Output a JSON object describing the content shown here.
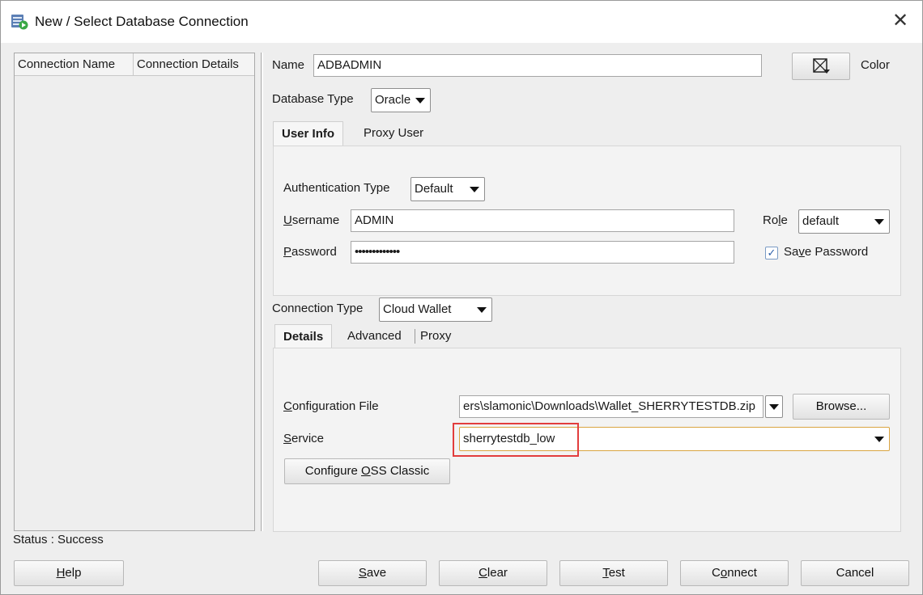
{
  "window": {
    "title": "New / Select Database Connection",
    "icons": {
      "app": "database-connection-icon",
      "close": "close-icon"
    }
  },
  "connection_list": {
    "columns": [
      "Connection Name",
      "Connection Details"
    ]
  },
  "form": {
    "name_label": "Name",
    "name_value": "ADBADMIN",
    "color_label": "Color",
    "database_type_label": "Database Type",
    "database_type_value": "Oracle",
    "tabs": [
      "User Info",
      "Proxy User"
    ],
    "active_tab": "User Info",
    "authentication_type_label": "Authentication Type",
    "authentication_type_value": "Default",
    "username_label": "Username",
    "username_value": "ADMIN",
    "password_label": "Password",
    "password_value": "•••••••••••••",
    "role_label": "Role",
    "role_value": "default",
    "save_password_label": "Save Password",
    "save_password_checked": true,
    "connection_type_label": "Connection Type",
    "connection_type_value": "Cloud Wallet",
    "detail_tabs": [
      "Details",
      "Advanced",
      "Proxy"
    ],
    "active_detail_tab": "Details",
    "configuration_file_label": "Configuration File",
    "configuration_file_value": "ers\\slamonic\\Downloads\\Wallet_SHERRYTESTDB.zip",
    "browse_label": "Browse...",
    "service_label": "Service",
    "service_value": "sherrytestdb_low",
    "configure_oss_label": "Configure OSS Classic"
  },
  "status": {
    "text": "Status : Success"
  },
  "buttons": {
    "help": "Help",
    "save": "Save",
    "clear": "Clear",
    "test": "Test",
    "connect": "Connect",
    "cancel": "Cancel"
  },
  "colors": {
    "highlight": "#e23d3d",
    "service_border": "#d9a441",
    "checkbox_check": "#2b5ea8"
  }
}
